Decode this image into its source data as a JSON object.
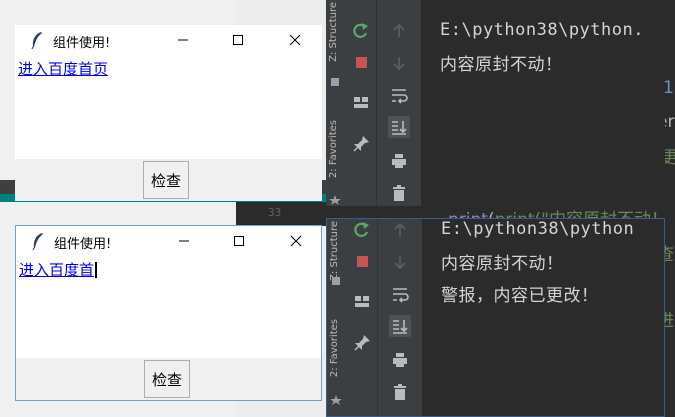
{
  "window_top": {
    "title": "组件使用!",
    "link_text": "进入百度首页",
    "check_button": "检查"
  },
  "window_bottom": {
    "title": "组件使用!",
    "link_text": "进入百度首",
    "check_button": "检查"
  },
  "console_top": {
    "lines": [
      "E:\\python38\\python.",
      "内容原封不动！"
    ]
  },
  "console_bottom": {
    "lines": [
      "E:\\python38\\python",
      "内容原封不动！",
      "警报，内容已更改！"
    ]
  },
  "side_tabs": {
    "structure": "Z: Structure",
    "favorites": "2: Favorites"
  },
  "editor_peek": {
    "code_text": "print(\"内容原封不动！",
    "line_number": "33",
    "fragment_1": "1",
    "fragment_2": "er",
    "fragment_3": "更",
    "fragment_4": "查",
    "fragment_5": "进"
  },
  "colors": {
    "link": "#0000ee",
    "console_text": "#d4d4d4",
    "rerun_green": "#59a869",
    "stop_red": "#c75450"
  }
}
